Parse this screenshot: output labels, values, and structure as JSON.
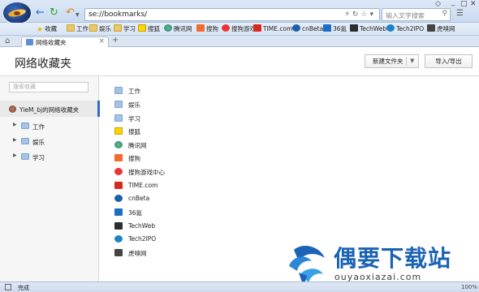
{
  "address": {
    "url": "se://bookmarks/"
  },
  "search": {
    "placeholder": "输入文字搜索"
  },
  "favorites_bar": {
    "items": [
      {
        "label": "收藏",
        "icon": "star-icon"
      },
      {
        "label": "工作",
        "icon": "folder-icon"
      },
      {
        "label": "娱乐",
        "icon": "folder-icon"
      },
      {
        "label": "学习",
        "icon": "folder-icon"
      },
      {
        "label": "搜狐",
        "icon": "sohu-icon"
      },
      {
        "label": "腾讯网",
        "icon": "qq-icon"
      },
      {
        "label": "搜狗",
        "icon": "sogou-icon"
      },
      {
        "label": "搜狗游戏",
        "icon": "sogou-game-icon"
      },
      {
        "label": "TIME.com",
        "icon": "time-icon"
      },
      {
        "label": "cnBeta",
        "icon": "cnbeta-icon"
      },
      {
        "label": "36氪",
        "icon": "36kr-icon"
      },
      {
        "label": "TechWeb",
        "icon": "techweb-icon"
      },
      {
        "label": "Tech2IPO",
        "icon": "tech2ipo-icon"
      },
      {
        "label": "虎嗅网",
        "icon": "huxiu-icon"
      }
    ]
  },
  "tabs": [
    {
      "label": "网络收藏夹"
    }
  ],
  "page": {
    "title": "网络收藏夹",
    "new_folder_label": "新建文件夹",
    "import_export_label": "导入/导出"
  },
  "sidebar": {
    "search_placeholder": "搜索收藏",
    "root_label": "YieM_bj的网络收藏夹",
    "folders": [
      {
        "label": "工作"
      },
      {
        "label": "娱乐"
      },
      {
        "label": "学习"
      }
    ]
  },
  "main_list": [
    {
      "label": "工作",
      "icon": "folder-icon"
    },
    {
      "label": "娱乐",
      "icon": "folder-icon"
    },
    {
      "label": "学习",
      "icon": "folder-icon"
    },
    {
      "label": "搜狐",
      "icon": "sohu-icon"
    },
    {
      "label": "腾讯网",
      "icon": "qq-icon"
    },
    {
      "label": "搜狗",
      "icon": "sogou-icon"
    },
    {
      "label": "搜狗游戏中心",
      "icon": "sogou-game-icon"
    },
    {
      "label": "TIME.com",
      "icon": "time-icon"
    },
    {
      "label": "cnBeta",
      "icon": "cnbeta-icon"
    },
    {
      "label": "36氪",
      "icon": "36kr-icon"
    },
    {
      "label": "TechWeb",
      "icon": "techweb-icon"
    },
    {
      "label": "Tech2IPO",
      "icon": "tech2ipo-icon"
    },
    {
      "label": "虎嗅网",
      "icon": "huxiu-icon"
    }
  ],
  "status": {
    "text": "完成",
    "zoom": "100%"
  },
  "watermark": {
    "brand": "偶要下载站",
    "url": "ouyaoxiazai.com"
  }
}
